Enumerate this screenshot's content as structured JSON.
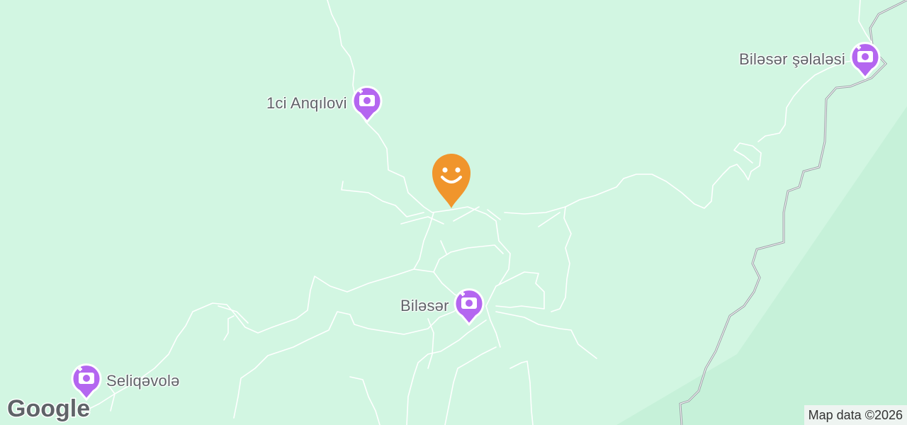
{
  "map": {
    "pois": [
      {
        "id": "anqilovi",
        "label": "1ci Anqılovi",
        "icon": "camera-icon"
      },
      {
        "id": "biloser-selalesi",
        "label": "Biləsər şəlaləsi",
        "icon": "camera-icon"
      },
      {
        "id": "biloser",
        "label": "Biləsər",
        "icon": "camera-icon"
      },
      {
        "id": "seliqevole",
        "label": "Seliqəvolə",
        "icon": "camera-icon"
      }
    ],
    "user_marker": {
      "icon": "smiley-icon",
      "color": "#f0952c"
    },
    "poi_color": "#b466f0",
    "land_color": "#d2f6e2",
    "forest_color": "#c2f0d6",
    "road_color": "#ffffff",
    "border_color": "#9aa0a6"
  },
  "footer": {
    "logo_text": "Google",
    "attribution": "Map data ©2026"
  }
}
